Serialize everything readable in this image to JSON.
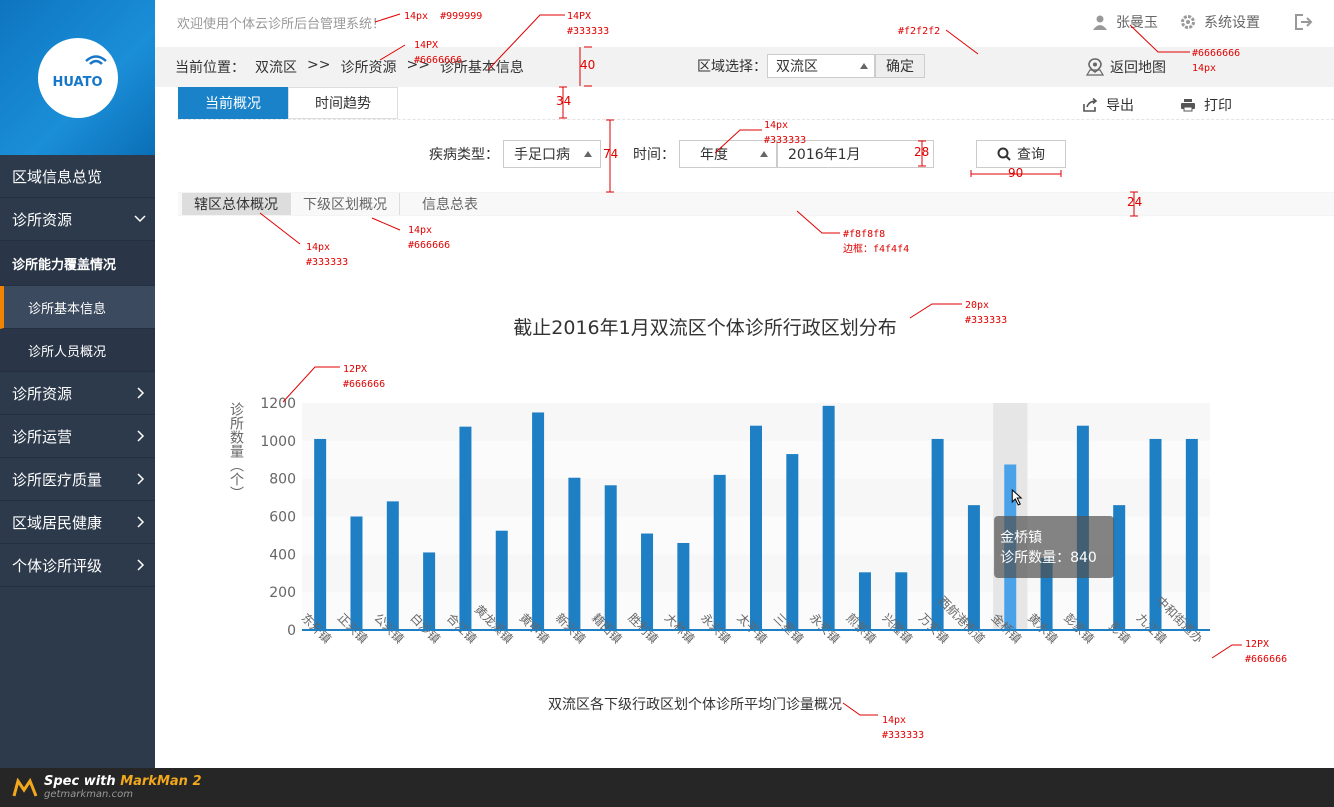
{
  "header": {
    "welcome": "欢迎使用个体云诊所后台管理系统！",
    "user_name": "张曼玉",
    "settings_label": "系统设置"
  },
  "logo": {
    "text": "HUATO"
  },
  "sidebar": {
    "items": [
      {
        "label": "区域信息总览"
      },
      {
        "label": "诊所资源"
      },
      {
        "label": "诊所能力覆盖情况"
      },
      {
        "label": "诊所基本信息"
      },
      {
        "label": "诊所人员概况"
      },
      {
        "label": "诊所资源"
      },
      {
        "label": "诊所运营"
      },
      {
        "label": "诊所医疗质量"
      },
      {
        "label": "区域居民健康"
      },
      {
        "label": "个体诊所评级"
      }
    ]
  },
  "breadcrumb": {
    "prefix": "当前位置：",
    "items": [
      "双流区",
      ">>",
      "诊所资源",
      ">>",
      "诊所基本信息"
    ]
  },
  "region": {
    "label": "区域选择：",
    "value": "双流区",
    "confirm": "确定",
    "back_map": "返回地图"
  },
  "tabs": [
    "当前概况",
    "时间趋势"
  ],
  "tools": {
    "export": "导出",
    "print": "打印"
  },
  "filters": {
    "disease_label": "疾病类型：",
    "disease_value": "手足口病",
    "time_label": "时间：",
    "time_value": "年度",
    "date_value": "2016年1月",
    "query": "查询"
  },
  "subtabs": [
    "辖区总体概况",
    "下级区划概况",
    "信息总表"
  ],
  "chart_data": {
    "type": "bar",
    "title": "截止2016年1月双流区个体诊所行政区划分布",
    "xlabel": "双流区各下级行政区划个体诊所平均门诊量概况",
    "ylabel": "诊所数量（个）",
    "ylim": [
      0,
      1200
    ],
    "yticks": [
      0,
      200,
      400,
      600,
      800,
      1000,
      1200
    ],
    "categories": [
      "东升镇",
      "正兴镇",
      "公兴镇",
      "白沙镇",
      "合江镇",
      "黄龙溪镇",
      "黄甲镇",
      "新兴镇",
      "籍田镇",
      "胜利镇",
      "大林镇",
      "永兴镇",
      "太平镇",
      "三星镇",
      "永安镇",
      "煎茶镇",
      "兴隆镇",
      "万安镇",
      "西航港街道",
      "金桥镇",
      "黄水镇",
      "彭家镇",
      "彭镇",
      "九江镇",
      "中和街道办"
    ],
    "values": [
      1010,
      600,
      680,
      410,
      1075,
      525,
      1150,
      805,
      765,
      510,
      460,
      820,
      1080,
      930,
      1185,
      305,
      305,
      1010,
      660,
      875,
      380,
      1080,
      660,
      1010,
      1010
    ],
    "highlight_index": 19,
    "tooltip": {
      "title": "金桥镇",
      "label": "诊所数量：840"
    },
    "colors": {
      "bar": "#1f7fc4",
      "bar_highlight": "#4aa3e8"
    }
  },
  "annotations": [
    "14px  #999999",
    "14PX\n#333333",
    "14PX\n#6666666",
    "40",
    "34",
    "74",
    "28",
    "90",
    "24",
    "#f2f2f2",
    "#6666666\n14px",
    "14px\n#333333",
    "14px\n#333333",
    "14px\n#666666",
    "#f8f8f8\n边框：f4f4f4",
    "20px\n#333333",
    "12PX\n#666666",
    "12PX\n#666666",
    "14px\n#333333"
  ],
  "footer": {
    "brand": "Spec with",
    "brand_accent": "MarkMan 2",
    "url": "getmarkman.com"
  }
}
